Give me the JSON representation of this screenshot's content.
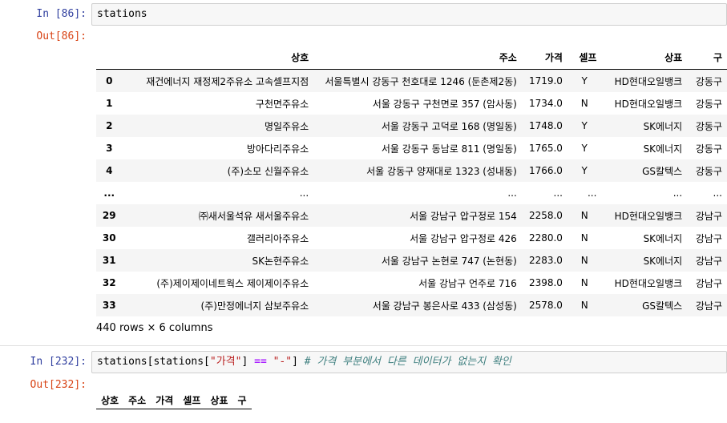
{
  "cell1": {
    "in_prompt": "In [86]:",
    "code": "stations",
    "out_prompt": "Out[86]:",
    "columns": [
      "",
      "상호",
      "주소",
      "가격",
      "셀프",
      "상표",
      "구"
    ],
    "rows": [
      [
        "0",
        "재건에너지 재정제2주유소 고속셀프지점",
        "서울특별시 강동구 천호대로 1246 (둔촌제2동)",
        "1719.0",
        "Y",
        "HD현대오일뱅크",
        "강동구"
      ],
      [
        "1",
        "구천면주유소",
        "서울 강동구 구천면로 357 (암사동)",
        "1734.0",
        "N",
        "HD현대오일뱅크",
        "강동구"
      ],
      [
        "2",
        "명일주유소",
        "서울 강동구 고덕로 168 (명일동)",
        "1748.0",
        "Y",
        "SK에너지",
        "강동구"
      ],
      [
        "3",
        "방아다리주유소",
        "서울 강동구 동남로 811 (명일동)",
        "1765.0",
        "Y",
        "SK에너지",
        "강동구"
      ],
      [
        "4",
        "(주)소모 신월주유소",
        "서울 강동구 양재대로 1323 (성내동)",
        "1766.0",
        "Y",
        "GS칼텍스",
        "강동구"
      ],
      [
        "...",
        "...",
        "...",
        "...",
        "...",
        "...",
        "..."
      ],
      [
        "29",
        "㈜새서울석유 새서울주유소",
        "서울 강남구 압구정로 154",
        "2258.0",
        "N",
        "HD현대오일뱅크",
        "강남구"
      ],
      [
        "30",
        "갤러리아주유소",
        "서울 강남구 압구정로 426",
        "2280.0",
        "N",
        "SK에너지",
        "강남구"
      ],
      [
        "31",
        "SK논현주유소",
        "서울 강남구 논현로 747 (논현동)",
        "2283.0",
        "N",
        "SK에너지",
        "강남구"
      ],
      [
        "32",
        "(주)제이제이네트웍스 제이제이주유소",
        "서울 강남구 언주로 716",
        "2398.0",
        "N",
        "HD현대오일뱅크",
        "강남구"
      ],
      [
        "33",
        "(주)만정에너지 삼보주유소",
        "서울 강남구 봉은사로 433 (삼성동)",
        "2578.0",
        "N",
        "GS칼텍스",
        "강남구"
      ]
    ],
    "footer": "440 rows × 6 columns"
  },
  "cell2": {
    "in_prompt": "In [232]:",
    "code_prefix": "stations[stations[",
    "code_str1": "\"가격\"",
    "code_mid": "] ",
    "code_op": "==",
    "code_sp": " ",
    "code_str2": "\"-\"",
    "code_close": "] ",
    "code_comment": "# 가격 부분에서 다른 데이터가 없는지 확인",
    "out_prompt": "Out[232]:",
    "columns": [
      "상호",
      "주소",
      "가격",
      "셀프",
      "상표",
      "구"
    ]
  }
}
